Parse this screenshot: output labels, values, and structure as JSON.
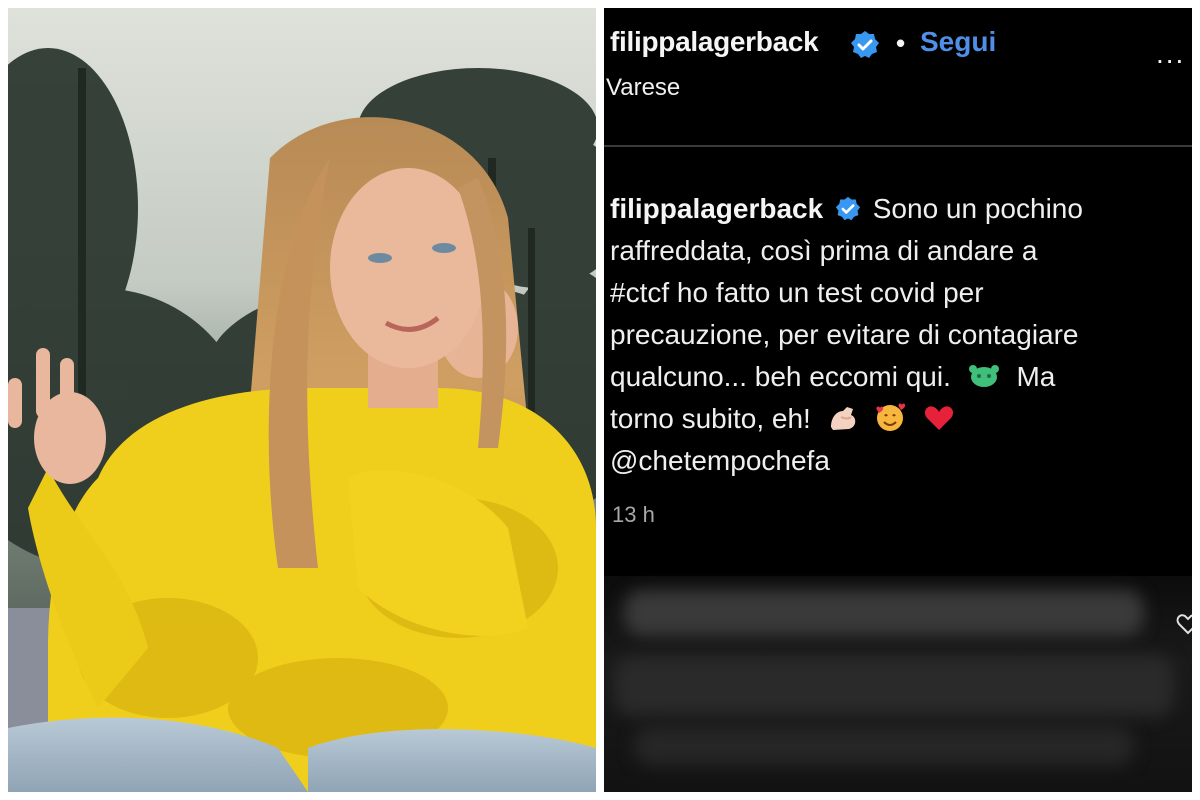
{
  "post": {
    "username": "filippalagerback",
    "follow_label": "Segui",
    "separator": "•",
    "location": "Varese",
    "more_label": "...",
    "caption_lines": [
      "Sono un pochino",
      "raffreddata, così prima di andare a",
      "#ctcf ho fatto un test covid per",
      "precauzione, per evitare di contagiare",
      "qualcuno... beh eccomi qui.",
      "Ma",
      "torno subito, eh!",
      "@chetempochefa"
    ],
    "timestamp": "13 h"
  },
  "icons": {
    "verified": "verified-badge-icon",
    "virus": "virus-emoji-icon",
    "muscle": "flexed-biceps-emoji-icon",
    "hearts_face": "smiling-face-with-hearts-emoji-icon",
    "heart": "red-heart-emoji-icon",
    "like": "heart-outline-icon",
    "more": "more-options-icon"
  },
  "colors": {
    "background": "#000000",
    "text": "#f5f5f5",
    "link": "#4f8fe8",
    "verified": "#3897f0",
    "muted": "#a8a8a8",
    "sweater": "#f2d21a"
  }
}
